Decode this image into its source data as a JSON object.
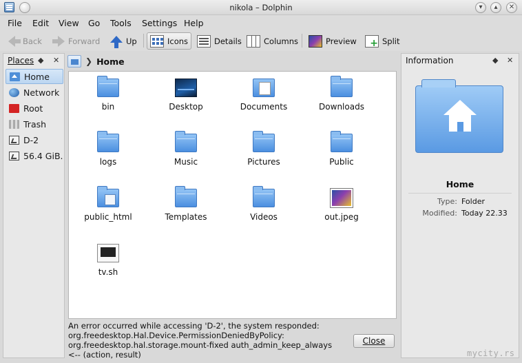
{
  "window": {
    "title": "nikola – Dolphin"
  },
  "menubar": {
    "items": [
      "File",
      "Edit",
      "View",
      "Go",
      "Tools",
      "Settings",
      "Help"
    ]
  },
  "toolbar": {
    "back": "Back",
    "forward": "Forward",
    "up": "Up",
    "icons": "Icons",
    "details": "Details",
    "columns": "Columns",
    "preview": "Preview",
    "split": "Split"
  },
  "places": {
    "title": "Places",
    "items": [
      {
        "label": "Home",
        "icon": "home-icon"
      },
      {
        "label": "Network",
        "icon": "network-icon"
      },
      {
        "label": "Root",
        "icon": "root-folder-icon"
      },
      {
        "label": "Trash",
        "icon": "trash-icon"
      },
      {
        "label": "D-2",
        "icon": "drive-icon"
      },
      {
        "label": "56.4 GiB...",
        "icon": "drive-icon"
      }
    ]
  },
  "breadcrumb": {
    "current": "Home"
  },
  "files": [
    {
      "name": "bin",
      "type": "folder"
    },
    {
      "name": "Desktop",
      "type": "desktop"
    },
    {
      "name": "Documents",
      "type": "documents"
    },
    {
      "name": "Downloads",
      "type": "folder"
    },
    {
      "name": "logs",
      "type": "folder"
    },
    {
      "name": "Music",
      "type": "folder"
    },
    {
      "name": "Pictures",
      "type": "folder"
    },
    {
      "name": "Public",
      "type": "folder"
    },
    {
      "name": "public_html",
      "type": "public"
    },
    {
      "name": "Templates",
      "type": "folder"
    },
    {
      "name": "Videos",
      "type": "folder"
    },
    {
      "name": "out.jpeg",
      "type": "image"
    },
    {
      "name": "tv.sh",
      "type": "script"
    }
  ],
  "error": {
    "message": "An error occurred while accessing 'D-2', the system responded: org.freedesktop.Hal.Device.PermissionDeniedByPolicy: org.freedesktop.hal.storage.mount-fixed auth_admin_keep_always <-- (action, result)",
    "close": "Close"
  },
  "info": {
    "title": "Information",
    "name": "Home",
    "type_label": "Type:",
    "type_value": "Folder",
    "modified_label": "Modified:",
    "modified_value": "Today 22.33"
  },
  "watermark": "mycity.rs",
  "colors": {
    "accent": "#4b8fe0",
    "selection": "#bcd6f1",
    "window_bg": "#d9d9d9"
  }
}
